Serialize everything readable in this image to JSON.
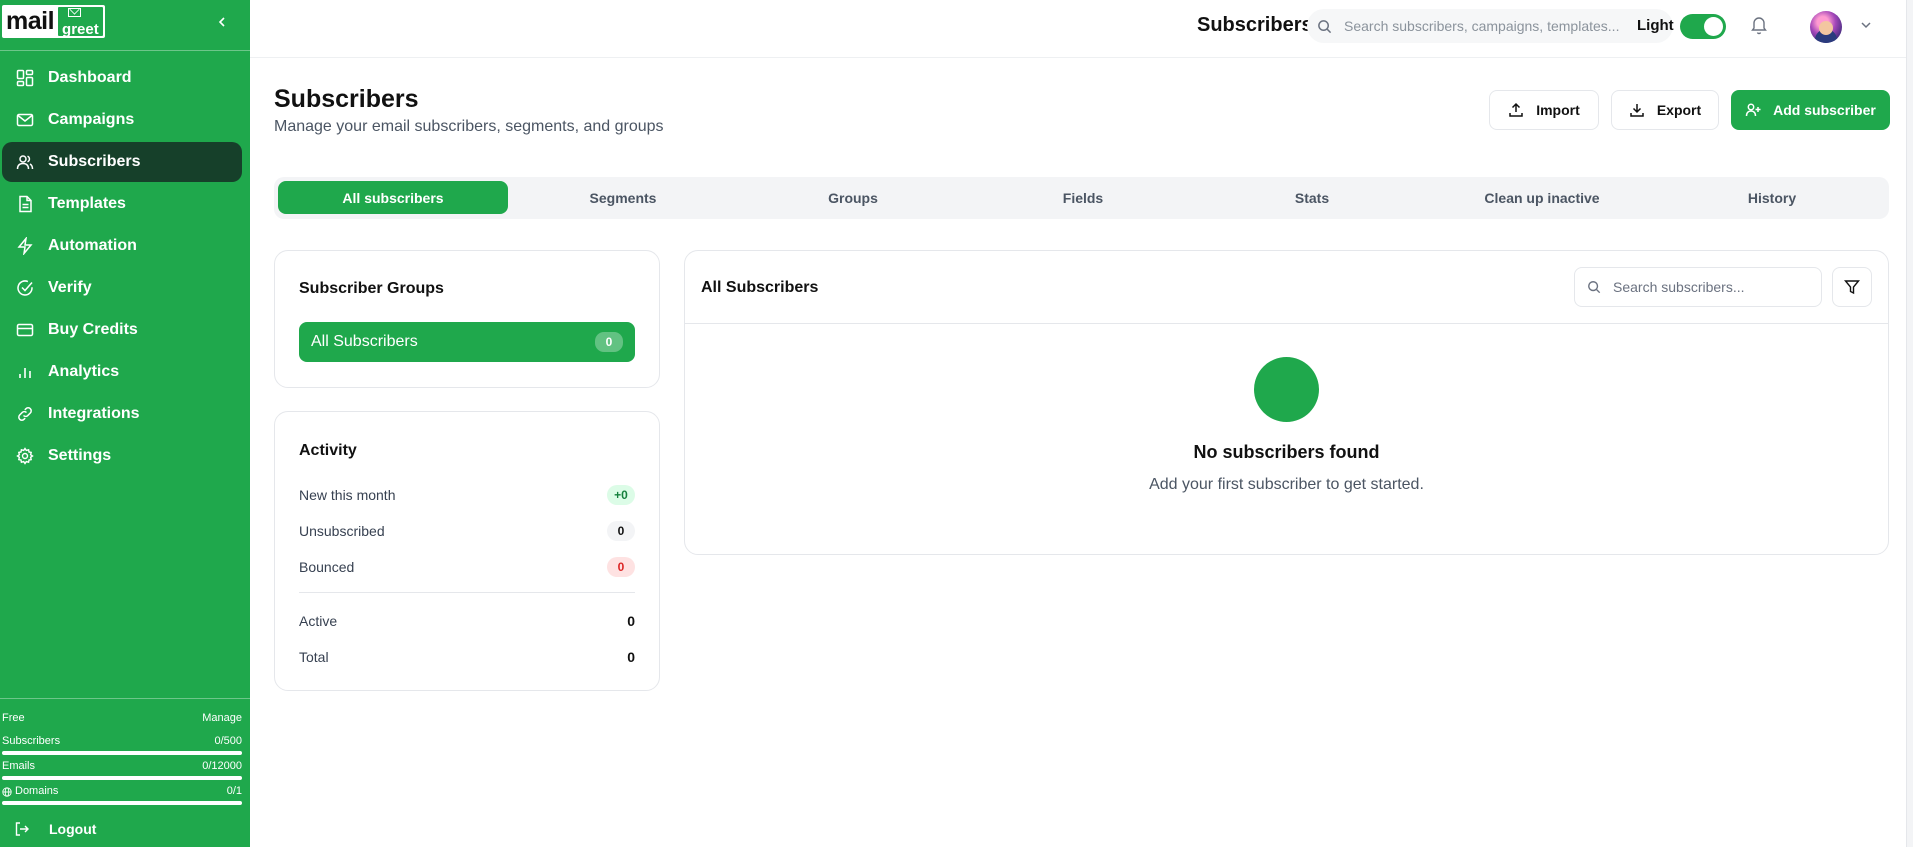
{
  "brand": {
    "mail": "mail",
    "greet": "greet"
  },
  "sidebar": {
    "items": [
      {
        "label": "Dashboard",
        "icon": "grid-icon"
      },
      {
        "label": "Campaigns",
        "icon": "mail-icon"
      },
      {
        "label": "Subscribers",
        "icon": "users-icon",
        "active": true
      },
      {
        "label": "Templates",
        "icon": "file-icon"
      },
      {
        "label": "Automation",
        "icon": "bolt-icon"
      },
      {
        "label": "Verify",
        "icon": "check-circle-icon"
      },
      {
        "label": "Buy Credits",
        "icon": "credit-card-icon"
      },
      {
        "label": "Analytics",
        "icon": "bar-chart-icon"
      },
      {
        "label": "Integrations",
        "icon": "link-icon"
      },
      {
        "label": "Settings",
        "icon": "gear-icon"
      }
    ],
    "plan": {
      "name": "Free",
      "manage": "Manage",
      "subscribers_label": "Subscribers",
      "subscribers_value": "0/500",
      "subscribers_used": 0,
      "emails_label": "Emails",
      "emails_value": "0/12000",
      "emails_used": 0,
      "domains_label": "Domains",
      "domains_value": "0/1",
      "domains_used": 0
    },
    "logout": "Logout"
  },
  "topbar": {
    "title": "Subscribers",
    "search_placeholder": "Search subscribers, campaigns, templates...",
    "theme_label": "Light",
    "theme_on": true
  },
  "header": {
    "title": "Subscribers",
    "subtitle": "Manage your email subscribers, segments, and groups",
    "import": "Import",
    "export": "Export",
    "add": "Add subscriber"
  },
  "tabs": [
    "All subscribers",
    "Segments",
    "Groups",
    "Fields",
    "Stats",
    "Clean up inactive",
    "History"
  ],
  "groups": {
    "title": "Subscriber Groups",
    "all_label": "All Subscribers",
    "all_count": "0"
  },
  "activity": {
    "title": "Activity",
    "new_label": "New this month",
    "new_value": "+0",
    "unsub_label": "Unsubscribed",
    "unsub_value": "0",
    "bounced_label": "Bounced",
    "bounced_value": "0",
    "active_label": "Active",
    "active_value": "0",
    "total_label": "Total",
    "total_value": "0"
  },
  "list": {
    "title": "All Subscribers",
    "search_placeholder": "Search subscribers...",
    "empty_title": "No subscribers found",
    "empty_sub": "Add your first subscriber to get started."
  },
  "colors": {
    "brand": "#1fa84c",
    "active_nav": "#16402a"
  }
}
